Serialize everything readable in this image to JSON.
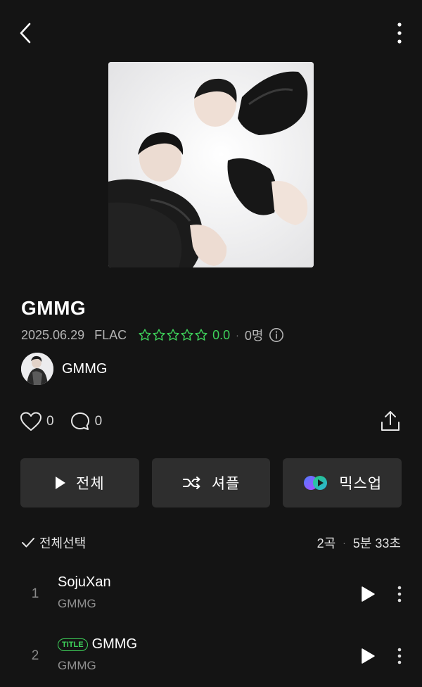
{
  "album": {
    "title": "GMMG",
    "release_date": "2025.06.29",
    "format": "FLAC",
    "rating": "0.0",
    "rating_count": "0명",
    "stars_filled": 0,
    "stars_total": 5
  },
  "artist": {
    "name": "GMMG"
  },
  "social": {
    "likes": "0",
    "comments": "0"
  },
  "actions": {
    "play_all": "전체",
    "shuffle": "셔플",
    "mixup": "믹스업"
  },
  "list": {
    "select_all": "전체선택",
    "track_count": "2곡",
    "duration": "5분 33초"
  },
  "tracks": [
    {
      "num": "1",
      "title": "SojuXan",
      "artist": "GMMG",
      "badge": ""
    },
    {
      "num": "2",
      "title": "GMMG",
      "artist": "GMMG",
      "badge": "TITLE"
    }
  ],
  "icons": {
    "back": "back-arrow-icon",
    "more": "vertical-dots-icon",
    "star": "star-outline-icon",
    "info": "info-circle-icon",
    "heart": "heart-outline-icon",
    "comment": "comment-bubble-icon",
    "share": "share-upload-icon",
    "play": "play-icon",
    "shuffle": "shuffle-icon",
    "mixup": "mixup-logo-icon",
    "check": "checkmark-icon"
  },
  "colors": {
    "background": "#141414",
    "button_bg": "#2e2e2e",
    "accent_green": "#3ed15a",
    "muted_text": "#8f8f8f"
  }
}
